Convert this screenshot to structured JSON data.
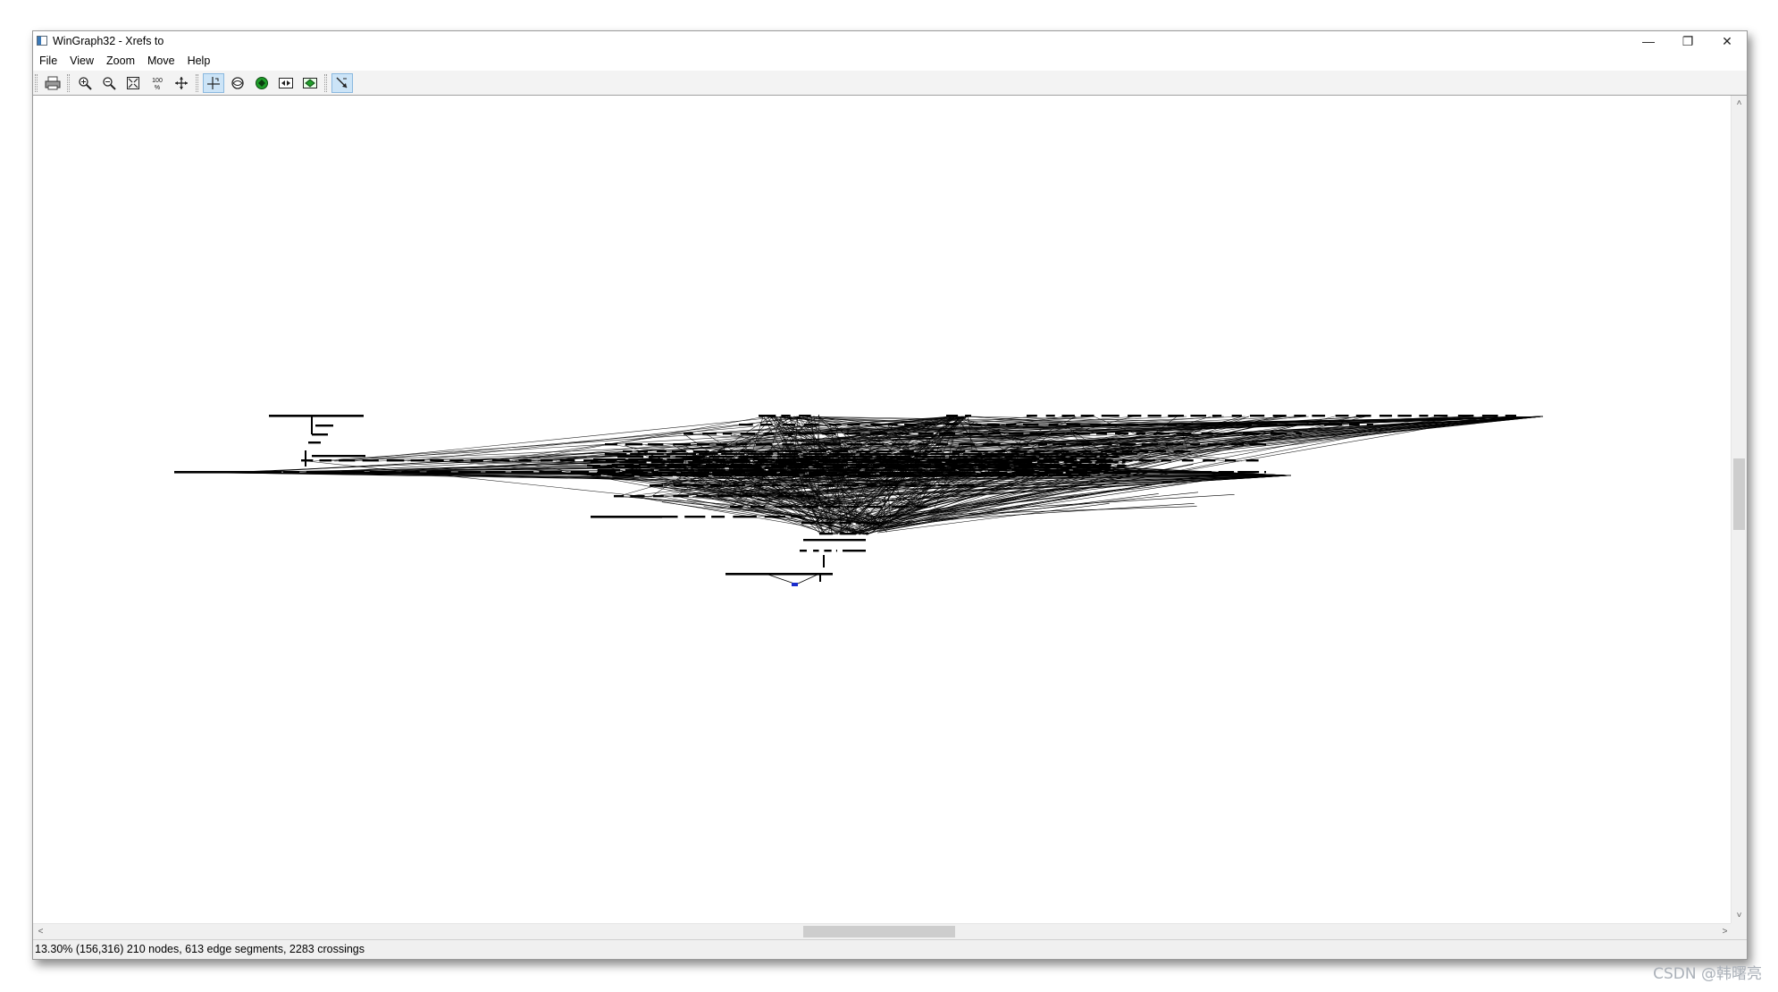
{
  "window": {
    "title": "WinGraph32 - Xrefs to",
    "minimize_glyph": "—",
    "restore_glyph": "❐",
    "close_glyph": "✕"
  },
  "menu": {
    "items": [
      "File",
      "View",
      "Zoom",
      "Move",
      "Help"
    ]
  },
  "toolbar": {
    "buttons": [
      {
        "icon": "print-icon"
      },
      {
        "icon": "zoom-in-icon"
      },
      {
        "icon": "zoom-out-icon"
      },
      {
        "icon": "fit-window-icon"
      },
      {
        "icon": "zoom-100-icon",
        "text": "100\n%"
      },
      {
        "icon": "move-icon"
      },
      {
        "icon": "layout-icon",
        "pressed": true
      },
      {
        "icon": "fisheye-icon"
      },
      {
        "icon": "green-node-icon"
      },
      {
        "icon": "export-icon"
      },
      {
        "icon": "green-frame-icon"
      },
      {
        "icon": "follow-edge-icon",
        "pressed": true
      }
    ]
  },
  "status": {
    "text": "13.30% (156,316) 210 nodes, 613 edge segments, 2283 crossings"
  },
  "scrollbars": {
    "up": "˄",
    "down": "˅",
    "left": "<",
    "right": ">"
  },
  "watermark": "CSDN @韩曙亮",
  "colors": {
    "graph_line": "#000000",
    "selected_node": "#1a2ccc",
    "pressed_button": "#cce4f7"
  }
}
